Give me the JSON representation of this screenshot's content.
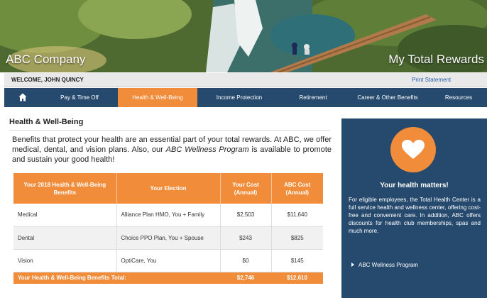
{
  "banner": {
    "company": "ABC Company",
    "title": "My Total Rewards"
  },
  "welcome": {
    "text": "WELCOME, JOHN QUINCY",
    "print_label": "Print Statement"
  },
  "nav": {
    "home_icon": "home-icon",
    "items": [
      {
        "label": "Pay & Time Off"
      },
      {
        "label": "Health & Well-Being"
      },
      {
        "label": "Income Protection"
      },
      {
        "label": "Retirement"
      },
      {
        "label": "Career & Other Benefits"
      },
      {
        "label": "Resources"
      }
    ],
    "active_index": 1
  },
  "main": {
    "section_title": "Health & Well-Being",
    "intro_1": "Benefits that protect your health are an essential part of your total rewards. At ABC, we offer medical, dental, and vision plans. Also, our ",
    "intro_program": "ABC Wellness Program",
    "intro_2": " is available to promote and sustain your good health!"
  },
  "table": {
    "headers": [
      "Your 2018 Health & Well-Being Benefits",
      "Your Election",
      "Your Cost (Annual)",
      "ABC Cost (Annual)"
    ],
    "rows": [
      {
        "benefit": "Medical",
        "election": "Alliance Plan HMO, You + Family",
        "your_cost": "$2,503",
        "abc_cost": "$11,640"
      },
      {
        "benefit": "Dental",
        "election": "Choice PPO Plan, You + Spouse",
        "your_cost": "$243",
        "abc_cost": "$825"
      },
      {
        "benefit": "Vision",
        "election": "OptiCare, You",
        "your_cost": "$0",
        "abc_cost": "$145"
      }
    ],
    "total": {
      "label": "Your Health & Well-Being Benefits Total:",
      "your_cost": "$2,746",
      "abc_cost": "$12,610"
    }
  },
  "sidebar": {
    "icon": "heart-icon",
    "heading": "Your health matters!",
    "body": "For eligible employees, the Total Health Center is a full service health and wellness center, offering cost-free and convenient care. In addition, ABC offers discounts for health club memberships, spas and much more.",
    "link": "ABC Wellness Program"
  },
  "colors": {
    "accent": "#f08c3a",
    "nav_bg": "#264a6e"
  }
}
